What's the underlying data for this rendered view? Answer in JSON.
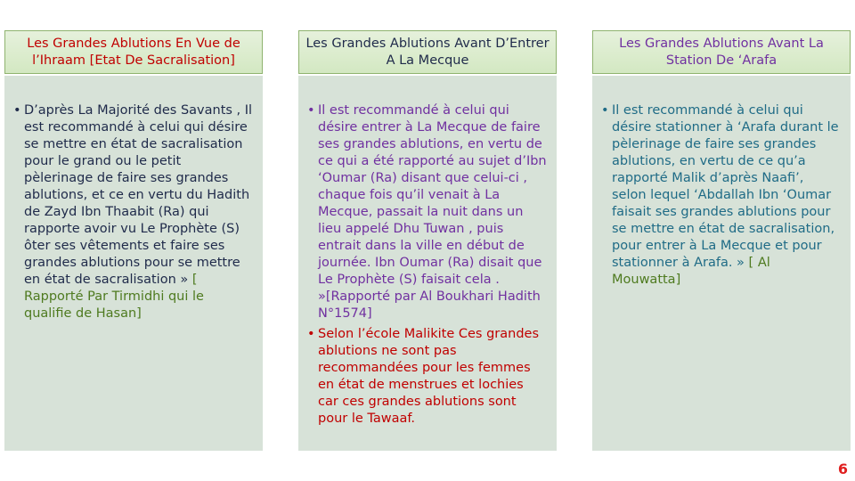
{
  "columns": [
    {
      "title": "Les Grandes Ablutions En Vue de l’Ihraam [Etat De Sacralisation]",
      "paragraphs": [
        {
          "main": "D’après La Majorité des Savants , Il est recommandé à celui qui désire se mettre en état de sacralisation pour le grand ou le petit pèlerinage de faire ses grandes ablutions, et ce en vertu du Hadith de Zayd Ibn Thaabit (Ra) qui rapporte avoir vu Le Prophète (S) ôter ses vêtements et faire ses grandes ablutions pour se mettre en état de sacralisation »",
          "ref": " [ Rapporté Par Tirmidhi qui le qualifie de Hasan]"
        }
      ]
    },
    {
      "title": "Les Grandes Ablutions Avant D’Entrer A La Mecque",
      "paragraphs": [
        {
          "main": "Il est recommandé à celui qui désire entrer à La Mecque de faire ses grandes ablutions, en vertu de ce qui a été rapporté au sujet d’Ibn ‘Oumar (Ra) disant que celui-ci , chaque fois qu’il venait à La Mecque, passait la nuit dans un lieu appelé Dhu Tuwan , puis entrait dans la ville en début de journée. Ibn Oumar (Ra) disait que Le Prophète (S) faisait cela . »",
          "ref": "[Rapporté par Al Boukhari Hadith N°1574]"
        },
        {
          "main": "Selon l’école Malikite Ces grandes ablutions ne sont pas recommandées pour les femmes en état de menstrues et lochies car ces grandes ablutions sont pour le Tawaaf.",
          "ref": ""
        }
      ]
    },
    {
      "title": "Les Grandes Ablutions Avant La Station De ‘Arafa",
      "paragraphs": [
        {
          "main": "Il est recommandé à celui qui désire stationner à ‘Arafa durant le pèlerinage de faire ses grandes ablutions, en vertu de ce qu’a rapporté Malik d’après Naafi’, selon lequel ‘Abdallah Ibn ‘Oumar faisait ses grandes ablutions pour se mettre en état de sacralisation, pour entrer à La Mecque et pour stationner à Arafa. »",
          "ref": " [ Al Mouwatta]"
        }
      ]
    }
  ],
  "page_number": "6",
  "colors": {
    "header_bg": "#d3e8c2",
    "body_bg": "#d7e2d8",
    "col1_header_text": "#c00000",
    "col2_header_text": "#1f2a4a",
    "col3_header_text": "#7030a0",
    "ref_text": "#4e7a1f"
  }
}
